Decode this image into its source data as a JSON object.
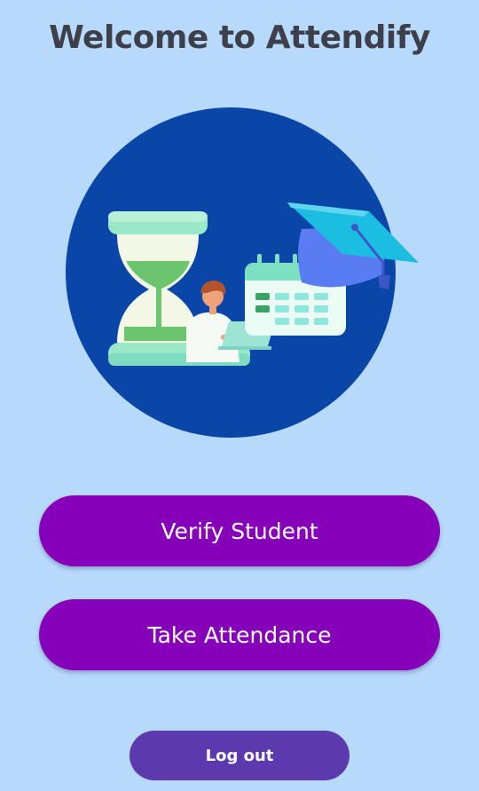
{
  "header": {
    "title": "Welcome to Attendify"
  },
  "illustration": {
    "description_icon": "attendance-illustration"
  },
  "actions": {
    "verify_student_label": "Verify Student",
    "take_attendance_label": "Take Attendance",
    "logout_label": "Log out"
  },
  "theme": {
    "background": "#b7d9fc",
    "primary_button": "#8600b9",
    "logout_button": "#5c3aad",
    "title_color": "#3d3f4a",
    "circle": "#0a45a8"
  }
}
